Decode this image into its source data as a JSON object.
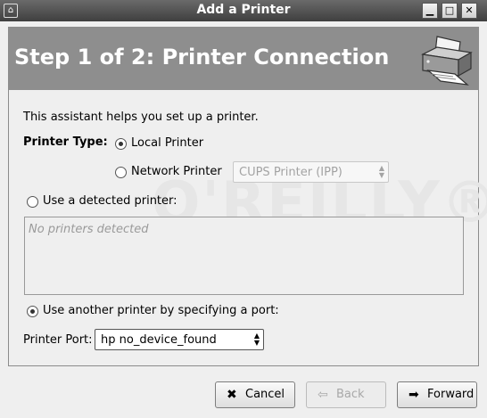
{
  "window": {
    "title": "Add a Printer",
    "menu_glyph": "⌂",
    "minimize_glyph": "▁",
    "maximize_glyph": "□",
    "close_glyph": "✕"
  },
  "header": {
    "step_title": "Step 1 of 2: Printer Connection",
    "icon": "printer-icon"
  },
  "watermark": "O'REILLY®",
  "intro": "This assistant helps you set up a printer.",
  "printer_type": {
    "label": "Printer Type:",
    "local_label": "Local Printer",
    "local_checked": true,
    "network_label": "Network Printer",
    "network_checked": false,
    "network_protocol": "CUPS Printer (IPP)"
  },
  "detected": {
    "label": "Use a detected printer:",
    "checked": false,
    "empty_text": "No printers detected"
  },
  "port": {
    "radio_label": "Use another printer by specifying a port:",
    "checked": true,
    "field_label": "Printer Port:",
    "value": "hp no_device_found"
  },
  "buttons": {
    "cancel": "Cancel",
    "back": "Back",
    "forward": "Forward"
  },
  "colors": {
    "header_bg": "#8e8e8e",
    "titlebar_bg": "#4a4a4a",
    "window_bg": "#efefef"
  }
}
